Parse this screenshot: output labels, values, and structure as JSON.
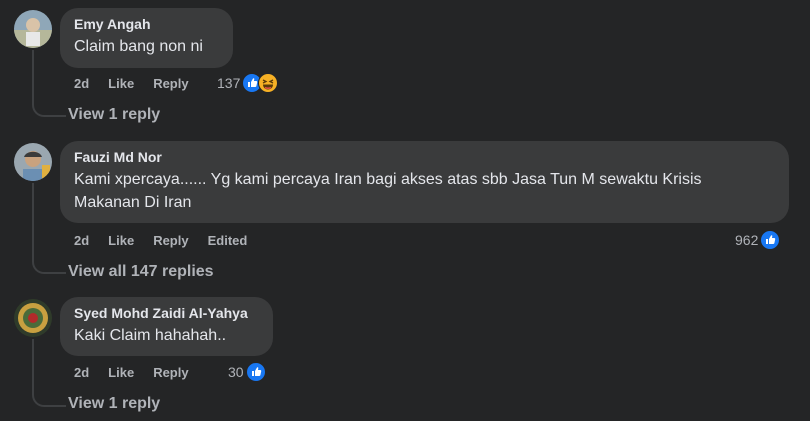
{
  "comments": [
    {
      "author": "Emy Angah",
      "text": "Claim bang non ni",
      "time": "2d",
      "like_label": "Like",
      "reply_label": "Reply",
      "edited_label": "",
      "reaction_count": "137",
      "reactions": [
        "like-icon",
        "haha-icon"
      ],
      "view_replies": "View 1 reply"
    },
    {
      "author": "Fauzi Md Nor",
      "text_line1": "Kami xpercaya...... Yg kami percaya Iran bagi akses atas sbb Jasa Tun M sewaktu Krisis",
      "text_line2": "Makanan Di Iran",
      "time": "2d",
      "like_label": "Like",
      "reply_label": "Reply",
      "edited_label": "Edited",
      "reaction_count": "962",
      "reactions": [
        "like-icon"
      ],
      "view_replies": "View all 147 replies"
    },
    {
      "author": "Syed Mohd Zaidi Al-Yahya",
      "text": "Kaki Claim hahahah..",
      "time": "2d",
      "like_label": "Like",
      "reply_label": "Reply",
      "edited_label": "",
      "reaction_count": "30",
      "reactions": [
        "like-icon"
      ],
      "view_replies": "View 1 reply"
    }
  ],
  "colors": {
    "background": "#242526",
    "bubble": "#3a3b3c",
    "primary_text": "#e4e6eb",
    "secondary_text": "#b0b3b8",
    "like_blue": "#1877f2",
    "haha_yellow": "#f7b125"
  }
}
